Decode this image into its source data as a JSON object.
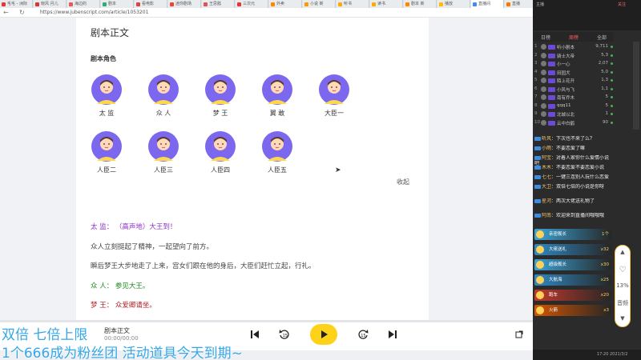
{
  "browser": {
    "tabs": [
      {
        "label": "毛毛 - 洲际",
        "color": "#e33"
      },
      {
        "label": "晓风 月儿",
        "color": "#d33"
      },
      {
        "label": "海边的",
        "color": "#e55"
      },
      {
        "label": "剧本",
        "color": "#3a7"
      },
      {
        "label": "看电影",
        "color": "#d44"
      },
      {
        "label": "迷你剧场",
        "color": "#e43"
      },
      {
        "label": "王思懿",
        "color": "#d55"
      },
      {
        "label": "三次元",
        "color": "#e33"
      },
      {
        "label": "外卖",
        "color": "#f80"
      },
      {
        "label": "小说 新",
        "color": "#f90"
      },
      {
        "label": "听书",
        "color": "#fa0"
      },
      {
        "label": "读书",
        "color": "#fa0"
      },
      {
        "label": "剧本 新",
        "color": "#f80"
      },
      {
        "label": "播放",
        "color": "#fb0"
      },
      {
        "label": "直播间",
        "color": "#48f"
      },
      {
        "label": "直播",
        "color": "#f70"
      }
    ],
    "url": "https://www.jubenscript.com/article/1053201",
    "back_glyph": "←",
    "refresh_glyph": "↻"
  },
  "document": {
    "title": "剧本正文",
    "roles_heading": "剧本角色",
    "roles": [
      "太 监",
      "众 人",
      "梦 王",
      "翼 敢",
      "大臣一",
      "人臣二",
      "人臣三",
      "人臣四",
      "人臣五"
    ],
    "collapse_label": "收起",
    "lines": [
      {
        "text": "太 监： （高声地）大王到！",
        "color": "purple"
      },
      {
        "text": "众人立刻挺起了精神，一起望向了前方。",
        "color": "gray"
      },
      {
        "text": "瞬后梦王大步地走了上来，宫女们跟在他的身后，大臣们赶忙立起，行礼。",
        "color": "gray"
      },
      {
        "text": "众 人： 参见大王。",
        "color": "green"
      },
      {
        "text": "梦 王： 众爱卿请坐。",
        "color": "red"
      }
    ]
  },
  "player": {
    "track_title": "剧本正文",
    "time": "00:00/00:00",
    "progress_percent": 0,
    "accent": "#ffd21a"
  },
  "overlay": {
    "line1": "双倍 七倍上限",
    "line2": "1个666成为粉丝团 活动道具今天到期~",
    "color": "#35a7e8"
  },
  "stream_panel": {
    "top_text": "主播",
    "top_right": "关注",
    "tabs": [
      "日榜",
      "周榜",
      "全部"
    ],
    "ranking": [
      {
        "rank": "1",
        "name": "听小剧本",
        "score": "9,711"
      },
      {
        "rank": "2",
        "name": "骑士大帝",
        "score": "5,3"
      },
      {
        "rank": "3",
        "name": "小一心",
        "score": "2,07"
      },
      {
        "rank": "4",
        "name": "田园犬",
        "score": "5,0"
      },
      {
        "rank": "5",
        "name": "陌上花开",
        "score": "1,3"
      },
      {
        "rank": "6",
        "name": "小风与飞",
        "score": "1,1"
      },
      {
        "rank": "7",
        "name": "南有乔木",
        "score": "5"
      },
      {
        "rank": "8",
        "name": "qqq11",
        "score": "5"
      },
      {
        "rank": "9",
        "name": "北城以北",
        "score": "1"
      },
      {
        "rank": "10",
        "name": "云中白鹤",
        "score": "90"
      }
    ],
    "chat": [
      {
        "user": "听风：",
        "text": "下次也不来了么？"
      },
      {
        "user": "小雨：",
        "text": "不要恋爱了嘛"
      },
      {
        "user": "阿宝：",
        "text": "对着人家你什么爱情小说吧"
      },
      {
        "user": "木木：",
        "text": "不要恋爱不要恋爱小说"
      },
      {
        "user": "七七：",
        "text": "一键三连别人玩什么恋爱"
      },
      {
        "user": "大卫：",
        "text": "双倍七倍的小说是你呀"
      },
      {
        "user": "星河：",
        "text": "两次大佬送礼物了"
      },
      {
        "user": "阿南：",
        "text": "欢迎来到直播间哦哦哦"
      }
    ],
    "gifts": [
      {
        "name": "亲密舰长",
        "count": "1个",
        "color": "#3aa3d6"
      },
      {
        "name": "大佬送礼",
        "count": "x32",
        "color": "#2e89c4"
      },
      {
        "name": "超级舰长",
        "count": "x30",
        "color": "#3aa3d6"
      },
      {
        "name": "大航海",
        "count": "x25",
        "color": "#2e89c4"
      },
      {
        "name": "跑车",
        "count": "x20",
        "color": "#c0392b"
      },
      {
        "name": "火箭",
        "count": "x3",
        "color": "#d35400"
      }
    ],
    "side_tools": [
      "▲",
      "♡",
      "13%",
      "音频",
      "▼"
    ],
    "bottom_text": "17:20 2021/3/2"
  }
}
